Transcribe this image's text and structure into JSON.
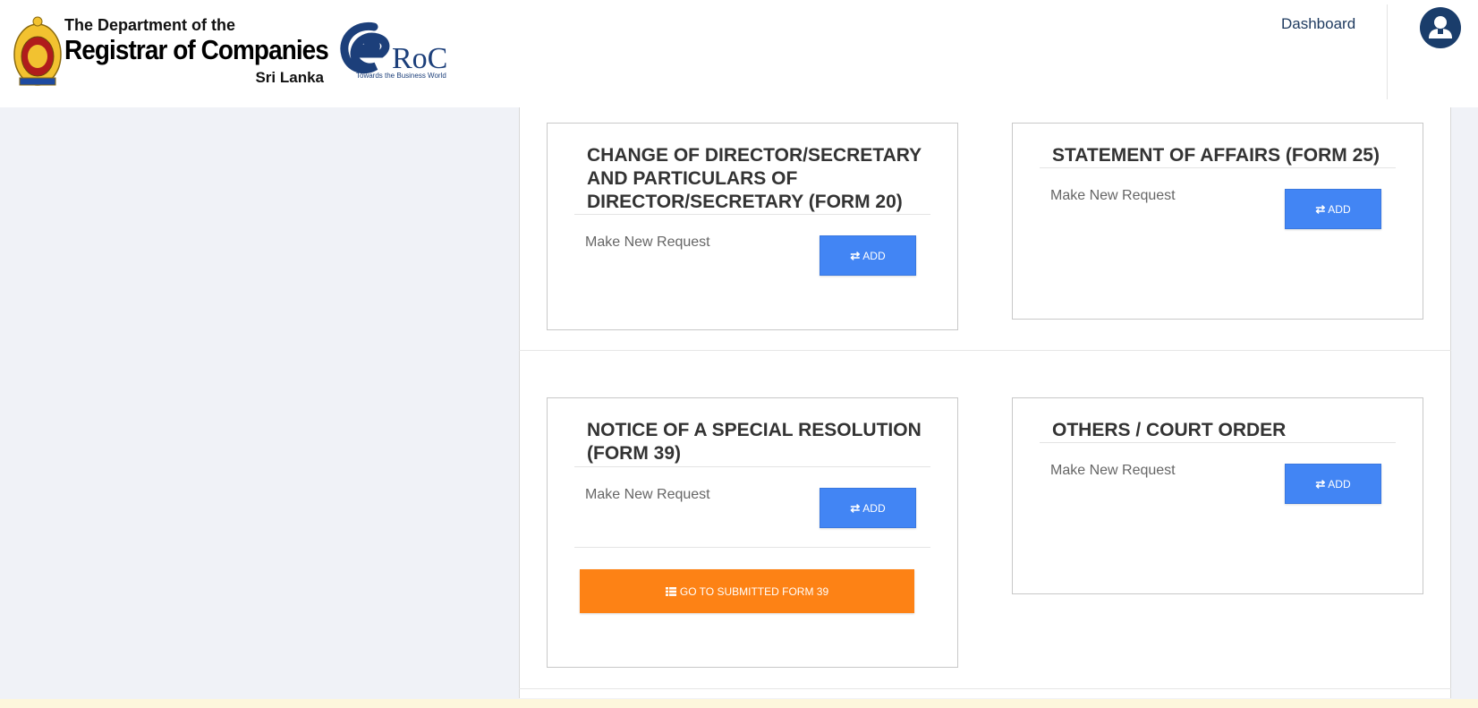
{
  "header": {
    "dept_line1": "The Department of the",
    "dept_line2": "Registrar of Companies",
    "dept_line3": "Sri Lanka",
    "eroc_logo_text": "RoC",
    "eroc_tagline": "Towards the Business World",
    "nav_dashboard": "Dashboard",
    "avatar_icon": "user-icon",
    "emblem_icon": "sri-lanka-emblem-icon"
  },
  "cards": {
    "form20": {
      "title": "CHANGE OF DIRECTOR/SECRETARY AND PARTICULARS OF DIRECTOR/SECRETARY (FORM 20)",
      "subtitle": "Make New Request",
      "add_label": "ADD"
    },
    "form25": {
      "title": "STATEMENT OF AFFAIRS (FORM 25)",
      "subtitle": "Make New Request",
      "add_label": "ADD"
    },
    "form39": {
      "title": "NOTICE OF A SPECIAL RESOLUTION (FORM 39)",
      "subtitle": "Make New Request",
      "add_label": "ADD",
      "submitted_label": "GO TO SUBMITTED FORM 39"
    },
    "court": {
      "title": "OTHERS / COURT ORDER",
      "subtitle": "Make New Request",
      "add_label": "ADD"
    }
  },
  "icons": {
    "add": "exchange-icon",
    "submitted": "table-list-icon"
  },
  "colors": {
    "primary_blue": "#4285f4",
    "orange": "#fd8215",
    "navy": "#1a3d6b"
  }
}
